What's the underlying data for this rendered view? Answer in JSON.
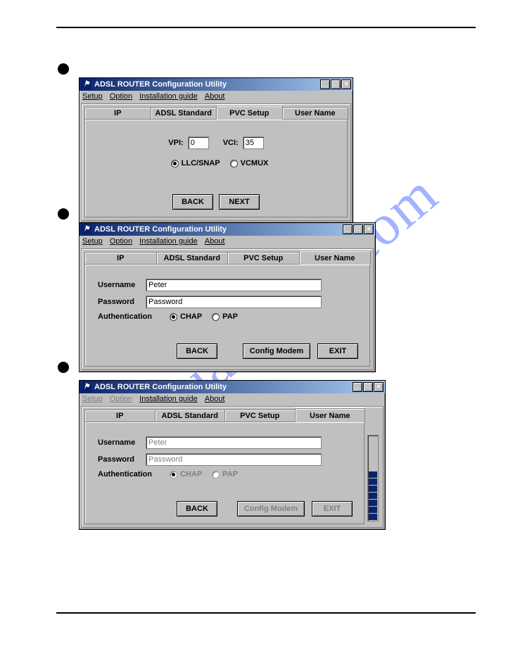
{
  "watermark": "manualshive.com",
  "windowTitle": "ADSL ROUTER Configuration Utility",
  "menu": {
    "setup": "Setup",
    "option": "Option",
    "guide": "Installation guide",
    "about": "About"
  },
  "tabs": {
    "ip": "IP",
    "adsl": "ADSL Standard",
    "pvc": "PVC Setup",
    "user": "User Name"
  },
  "win1": {
    "vpiLabel": "VPI:",
    "vpi": "0",
    "vciLabel": "VCI:",
    "vci": "35",
    "mux1": "LLC/SNAP",
    "mux2": "VCMUX",
    "back": "BACK",
    "next": "NEXT"
  },
  "win2": {
    "usernameLabel": "Username",
    "username": "Peter",
    "passwordLabel": "Password",
    "password": "Password",
    "authLabel": "Authentication",
    "chap": "CHAP",
    "pap": "PAP",
    "back": "BACK",
    "config": "Config Modem",
    "exit": "EXIT"
  },
  "win3": {
    "usernameLabel": "Username",
    "username": "Peter",
    "passwordLabel": "Password",
    "password": "Password",
    "authLabel": "Authentication",
    "chap": "CHAP",
    "pap": "PAP",
    "back": "BACK",
    "config": "Config Modem",
    "exit": "EXIT",
    "progressSegments": 7
  }
}
